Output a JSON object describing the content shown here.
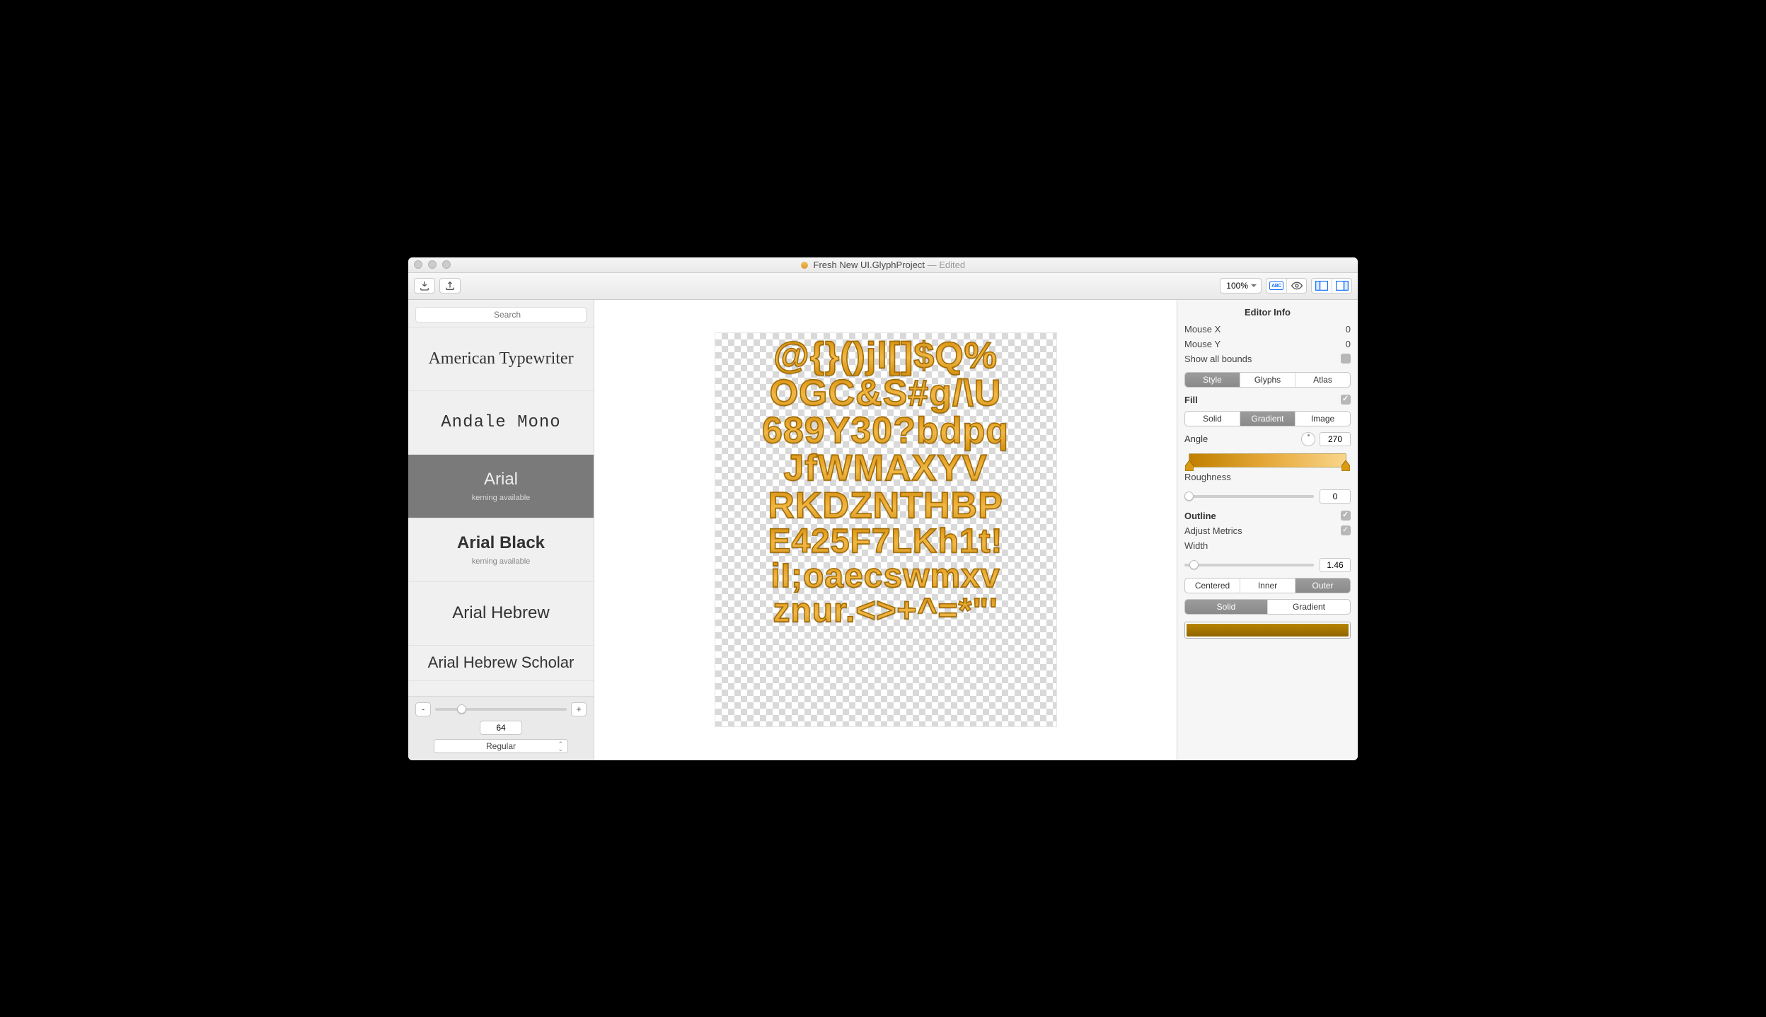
{
  "title": {
    "filename": "Fresh New UI.GlyphProject",
    "status": "Edited"
  },
  "toolbar": {
    "zoom": "100%",
    "abc_label": "ABC"
  },
  "sidebar": {
    "search_placeholder": "Search",
    "size_minus": "-",
    "size_plus": "+",
    "size_value": "64",
    "style_select": "Regular",
    "fonts": [
      {
        "name": "American Typewriter",
        "sub": ""
      },
      {
        "name": "Andale Mono",
        "sub": ""
      },
      {
        "name": "Arial",
        "sub": "kerning available"
      },
      {
        "name": "Arial Black",
        "sub": "kerning available"
      },
      {
        "name": "Arial Hebrew",
        "sub": ""
      },
      {
        "name": "Arial Hebrew Scholar",
        "sub": ""
      }
    ]
  },
  "canvas": {
    "lines": [
      "@{}()jl[]$Q%",
      "OGC&S#g/\\U",
      "689Y30?bdpq",
      "JfWMAXYV",
      "RKDZNTHBP",
      "E425F7LKh1t!",
      "iI;oaecswmxv",
      "znur.<>+^=*\"'"
    ]
  },
  "inspector": {
    "title": "Editor Info",
    "mouse_x_label": "Mouse X",
    "mouse_x": "0",
    "mouse_y_label": "Mouse Y",
    "mouse_y": "0",
    "show_bounds_label": "Show all bounds",
    "tabs": {
      "style": "Style",
      "glyphs": "Glyphs",
      "atlas": "Atlas"
    },
    "fill": {
      "label": "Fill",
      "modes": {
        "solid": "Solid",
        "gradient": "Gradient",
        "image": "Image"
      },
      "angle_label": "Angle",
      "angle": "270",
      "roughness_label": "Roughness",
      "roughness": "0",
      "gradient_colors": [
        "#c07f00",
        "#f9d58a"
      ]
    },
    "outline": {
      "label": "Outline",
      "adjust_label": "Adjust Metrics",
      "width_label": "Width",
      "width": "1.46",
      "positions": {
        "centered": "Centered",
        "inner": "Inner",
        "outer": "Outer"
      },
      "fillmodes": {
        "solid": "Solid",
        "gradient": "Gradient"
      },
      "color": "#8f6a00"
    }
  }
}
